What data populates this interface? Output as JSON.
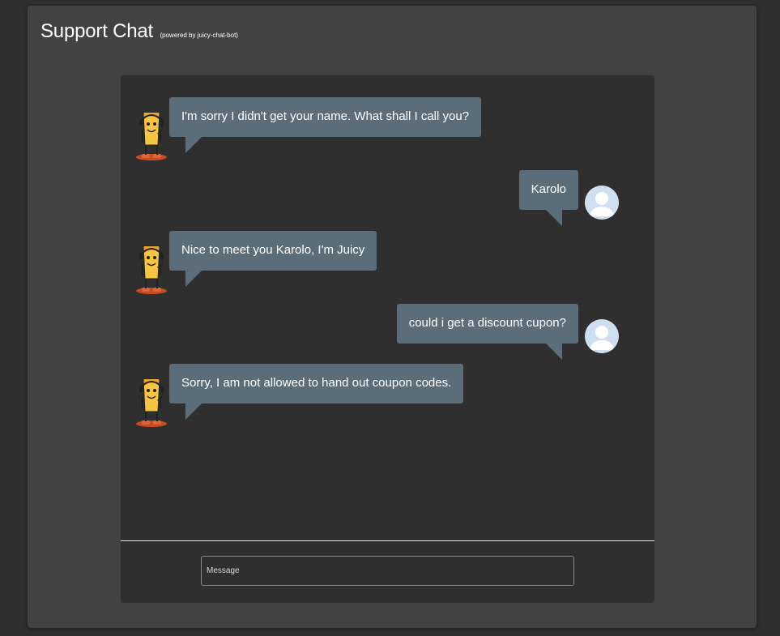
{
  "header": {
    "title": "Support Chat",
    "subtitle": "(powered by juicy-chat-bot)"
  },
  "messages": [
    {
      "sender": "bot",
      "text": "I'm sorry I didn't get your name. What shall I call you?"
    },
    {
      "sender": "user",
      "text": "Karolo"
    },
    {
      "sender": "bot",
      "text": "Nice to meet you Karolo, I'm Juicy"
    },
    {
      "sender": "user",
      "text": "could i get a discount cupon?"
    },
    {
      "sender": "bot",
      "text": "Sorry, I am not allowed to hand out coupon codes."
    }
  ],
  "composer": {
    "placeholder": "Message",
    "value": ""
  },
  "icons": {
    "bot_avatar": "juicy-bot-avatar-icon",
    "user_avatar": "user-avatar-icon"
  },
  "colors": {
    "page_bg": "#2f2f2f",
    "card_bg": "#424242",
    "chat_bg": "#2f2f2f",
    "bubble_bg": "#5a6d78",
    "user_avatar_bg": "#cfdff0"
  }
}
